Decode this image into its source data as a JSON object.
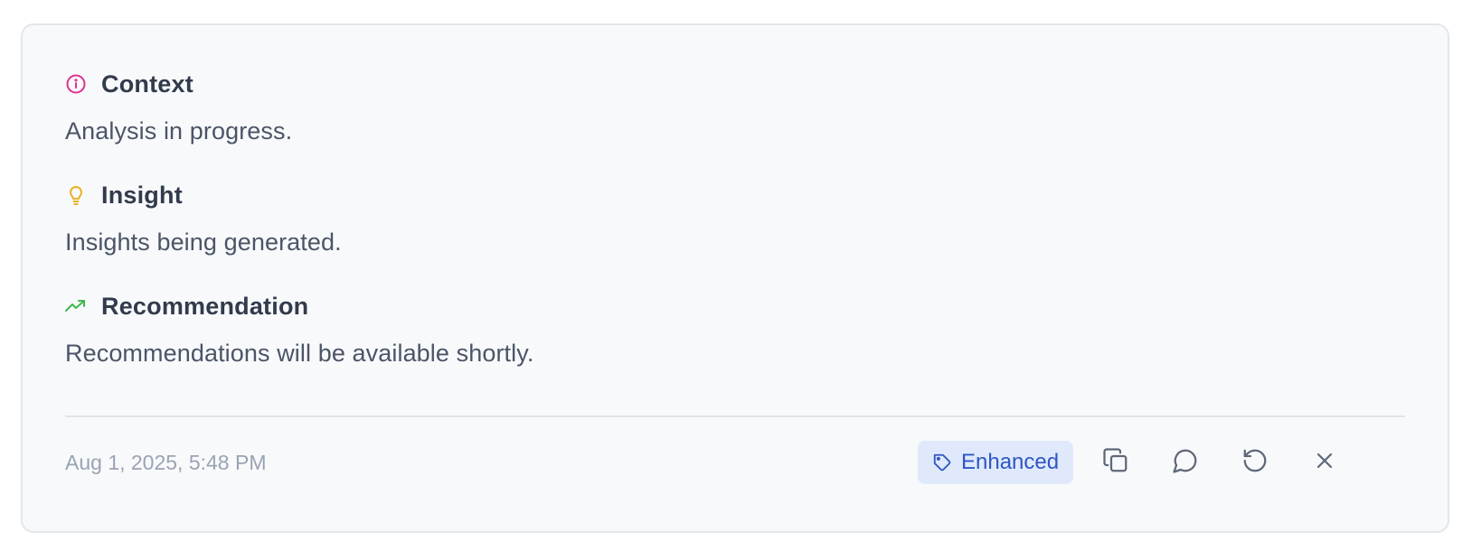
{
  "sections": [
    {
      "title": "Context",
      "text": "Analysis in progress.",
      "icon": "info-icon",
      "icon_color": "#e0318f"
    },
    {
      "title": "Insight",
      "text": "Insights being generated.",
      "icon": "lightbulb-icon",
      "icon_color": "#e8b224"
    },
    {
      "title": "Recommendation",
      "text": "Recommendations will be available shortly.",
      "icon": "trending-up-icon",
      "icon_color": "#3fb650"
    }
  ],
  "footer": {
    "timestamp": "Aug 1, 2025, 5:48 PM",
    "tag_label": "Enhanced",
    "tag_icon": "tag-icon",
    "actions": [
      "copy-icon",
      "comment-icon",
      "refresh-icon",
      "close-icon"
    ]
  },
  "colors": {
    "card_bg": "#f8f9fb",
    "title": "#323b4c",
    "body_text": "#4b5567",
    "muted": "#9aa3b2",
    "tag_bg": "#dfe9fb",
    "tag_text": "#2f56c5",
    "action_icon": "#5f6878"
  }
}
